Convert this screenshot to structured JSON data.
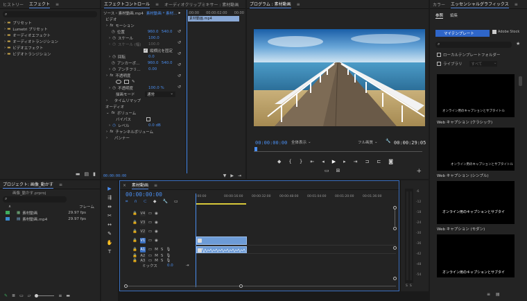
{
  "project_panel_top": {
    "tabs": [
      "ヒストリー",
      "エフェクト",
      "≡"
    ],
    "items": [
      "プリセット",
      "Lumetri プリセット",
      "オーディオエフェクト",
      "オーディオトランジション",
      "ビデオエフェクト",
      "ビデオトランジション"
    ]
  },
  "effect_controls": {
    "tabs": [
      "エフェクトコントロール",
      "≡",
      "オーディオクリップミキサー : 素材動画"
    ],
    "source": "ソース・素材動画.mp4",
    "seq": "素材動画 * 素材…",
    "clip_label": "素材動画.mp4",
    "time_start": ":00:00",
    "time_mid": "00:00:02:00",
    "time_end": "00:00",
    "section_video": "ビデオ",
    "motion": "モーション",
    "position_label": "位置",
    "position_x": "960.0",
    "position_y": "540.0",
    "scale_label": "スケール",
    "scale_val": "100.0",
    "scale_w_label": "スケール (幅)",
    "scale_w_val": "100.0",
    "uniform_label": "縦横比を固定",
    "rotation_label": "回転",
    "rotation_val": "0.0",
    "anchor_label": "アンカーポ…",
    "anchor_x": "960.0",
    "anchor_y": "540.0",
    "flicker_label": "アンチフリ…",
    "flicker_val": "0.00",
    "opacity_title": "不透明度",
    "opacity_label": "不透明度",
    "opacity_val": "100.0 %",
    "blend_label": "描画モード",
    "blend_val": "通常",
    "timeremap": "タイムリマップ",
    "section_audio": "オーディオ",
    "volume": "ボリューム",
    "bypass": "バイパス",
    "level_label": "レベル",
    "level_val": "0.0 dB",
    "channel_volume": "チャンネルボリューム",
    "panner": "パンナー",
    "footer_time": "00:00:00:00"
  },
  "program": {
    "tab": "プログラム : 素材動画",
    "timecode": "00:00:00:00",
    "fit": "全体表示",
    "quality": "フル画質",
    "duration": "00:00:29:05"
  },
  "essential": {
    "tabs": [
      "カラー",
      "エッセンシャルグラフィックス",
      "≡"
    ],
    "subtabs": [
      "参照",
      "編集"
    ],
    "my_templates": "マイテンプレート",
    "adobe_stock": "Adobe Stock",
    "local_folder": "ローカルテンプレートフォルダー",
    "library": "ライブラリ",
    "library_sel": "すべて",
    "captions": [
      "Web キャプション (クラシック)",
      "Web キャプション (シンプル)",
      "Web キャプション (モダン)"
    ],
    "thumb_texts": [
      "オンライン用のキャプションとサブタイトル",
      "オンライン用のキャプションとサブタイトル",
      "オンライン用のキャプションとサブタイ",
      "オンライン用のキャプションとサブタイ"
    ]
  },
  "project": {
    "tab": "プロジェクト: 画像_動かす",
    "file": "画像_動かす.prproj",
    "col_rate": "フレーム",
    "items": [
      {
        "name": "素材動画",
        "fps": "29.97 fps"
      },
      {
        "name": "素材動画.mp4",
        "fps": "29.97 fps"
      }
    ]
  },
  "timeline": {
    "tab": "素材動画",
    "timecode": "00:00:00:00",
    "ruler": [
      ":00:00",
      "00:00:16:00",
      "00:00:32:00",
      "00:00:48:00",
      "00:01:04:00",
      "00:01:20:00",
      "00:01:36:00",
      "00:01:52:00"
    ],
    "video_tracks": [
      "V4",
      "V3",
      "V2",
      "V1"
    ],
    "audio_tracks": [
      "A1",
      "A2",
      "A3"
    ],
    "mix_label": "ミックス",
    "mix_val": "0.0",
    "m": "M",
    "s": "S",
    "clip_v": "fx",
    "meter_db": [
      "-6",
      "-12",
      "-18",
      "-24",
      "-30",
      "-36",
      "-42",
      "-48",
      "-54"
    ],
    "meter_foot": [
      "S",
      "S"
    ]
  }
}
